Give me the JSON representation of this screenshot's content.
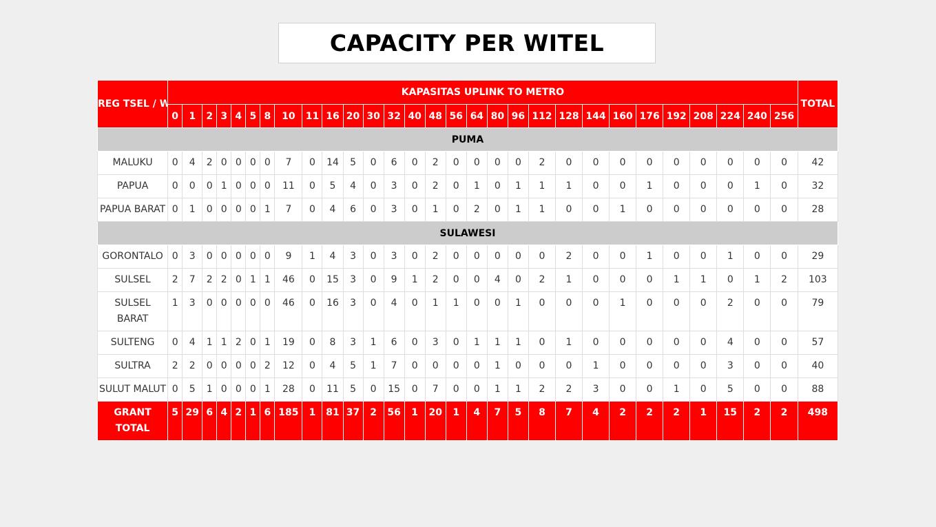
{
  "title": "CAPACITY PER WITEL",
  "table": {
    "corner_header": "REG TSEL / WITEL",
    "group_header": "KAPASITAS UPLINK TO METRO",
    "total_header": "TOTAL",
    "columns": [
      "0",
      "1",
      "2",
      "3",
      "4",
      "5",
      "8",
      "10",
      "11",
      "16",
      "20",
      "30",
      "32",
      "40",
      "48",
      "56",
      "64",
      "80",
      "96",
      "112",
      "128",
      "144",
      "160",
      "176",
      "192",
      "208",
      "224",
      "240",
      "256"
    ],
    "sections": [
      {
        "name": "PUMA",
        "rows": [
          {
            "name": "MALUKU",
            "values": [
              "0",
              "4",
              "2",
              "0",
              "0",
              "0",
              "0",
              "7",
              "0",
              "14",
              "5",
              "0",
              "6",
              "0",
              "2",
              "0",
              "0",
              "0",
              "0",
              "2",
              "0",
              "0",
              "0",
              "0",
              "0",
              "0",
              "0",
              "0",
              "0"
            ],
            "total": "42"
          },
          {
            "name": "PAPUA",
            "values": [
              "0",
              "0",
              "0",
              "1",
              "0",
              "0",
              "0",
              "11",
              "0",
              "5",
              "4",
              "0",
              "3",
              "0",
              "2",
              "0",
              "1",
              "0",
              "1",
              "1",
              "1",
              "0",
              "0",
              "1",
              "0",
              "0",
              "0",
              "1",
              "0"
            ],
            "total": "32"
          },
          {
            "name": "PAPUA BARAT",
            "values": [
              "0",
              "1",
              "0",
              "0",
              "0",
              "0",
              "1",
              "7",
              "0",
              "4",
              "6",
              "0",
              "3",
              "0",
              "1",
              "0",
              "2",
              "0",
              "1",
              "1",
              "0",
              "0",
              "1",
              "0",
              "0",
              "0",
              "0",
              "0",
              "0"
            ],
            "total": "28"
          }
        ]
      },
      {
        "name": "SULAWESI",
        "rows": [
          {
            "name": "GORONTALO",
            "values": [
              "0",
              "3",
              "0",
              "0",
              "0",
              "0",
              "0",
              "9",
              "1",
              "4",
              "3",
              "0",
              "3",
              "0",
              "2",
              "0",
              "0",
              "0",
              "0",
              "0",
              "2",
              "0",
              "0",
              "1",
              "0",
              "0",
              "1",
              "0",
              "0"
            ],
            "total": "29"
          },
          {
            "name": "SULSEL",
            "values": [
              "2",
              "7",
              "2",
              "2",
              "0",
              "1",
              "1",
              "46",
              "0",
              "15",
              "3",
              "0",
              "9",
              "1",
              "2",
              "0",
              "0",
              "4",
              "0",
              "2",
              "1",
              "0",
              "0",
              "0",
              "1",
              "1",
              "0",
              "1",
              "2"
            ],
            "total": "103"
          },
          {
            "name": "SULSEL BARAT",
            "values": [
              "1",
              "3",
              "0",
              "0",
              "0",
              "0",
              "0",
              "46",
              "0",
              "16",
              "3",
              "0",
              "4",
              "0",
              "1",
              "1",
              "0",
              "0",
              "1",
              "0",
              "0",
              "0",
              "1",
              "0",
              "0",
              "0",
              "2",
              "0",
              "0"
            ],
            "total": "79"
          },
          {
            "name": "SULTENG",
            "values": [
              "0",
              "4",
              "1",
              "1",
              "2",
              "0",
              "1",
              "19",
              "0",
              "8",
              "3",
              "1",
              "6",
              "0",
              "3",
              "0",
              "1",
              "1",
              "1",
              "0",
              "1",
              "0",
              "0",
              "0",
              "0",
              "0",
              "4",
              "0",
              "0"
            ],
            "total": "57"
          },
          {
            "name": "SULTRA",
            "values": [
              "2",
              "2",
              "0",
              "0",
              "0",
              "0",
              "2",
              "12",
              "0",
              "4",
              "5",
              "1",
              "7",
              "0",
              "0",
              "0",
              "0",
              "1",
              "0",
              "0",
              "0",
              "1",
              "0",
              "0",
              "0",
              "0",
              "3",
              "0",
              "0"
            ],
            "total": "40"
          },
          {
            "name": "SULUT MALUT",
            "values": [
              "0",
              "5",
              "1",
              "0",
              "0",
              "0",
              "1",
              "28",
              "0",
              "11",
              "5",
              "0",
              "15",
              "0",
              "7",
              "0",
              "0",
              "1",
              "1",
              "2",
              "2",
              "3",
              "0",
              "0",
              "1",
              "0",
              "5",
              "0",
              "0"
            ],
            "total": "88"
          }
        ]
      }
    ],
    "grand_total": {
      "label": "GRANT TOTAL",
      "values": [
        "5",
        "29",
        "6",
        "4",
        "2",
        "1",
        "6",
        "185",
        "1",
        "81",
        "37",
        "2",
        "56",
        "1",
        "20",
        "1",
        "4",
        "7",
        "5",
        "8",
        "7",
        "4",
        "2",
        "2",
        "2",
        "1",
        "15",
        "2",
        "2"
      ],
      "total": "498"
    }
  },
  "colors": {
    "header_red": "#ff0000",
    "section_gray": "#cccccc",
    "page_background": "#efefef"
  }
}
